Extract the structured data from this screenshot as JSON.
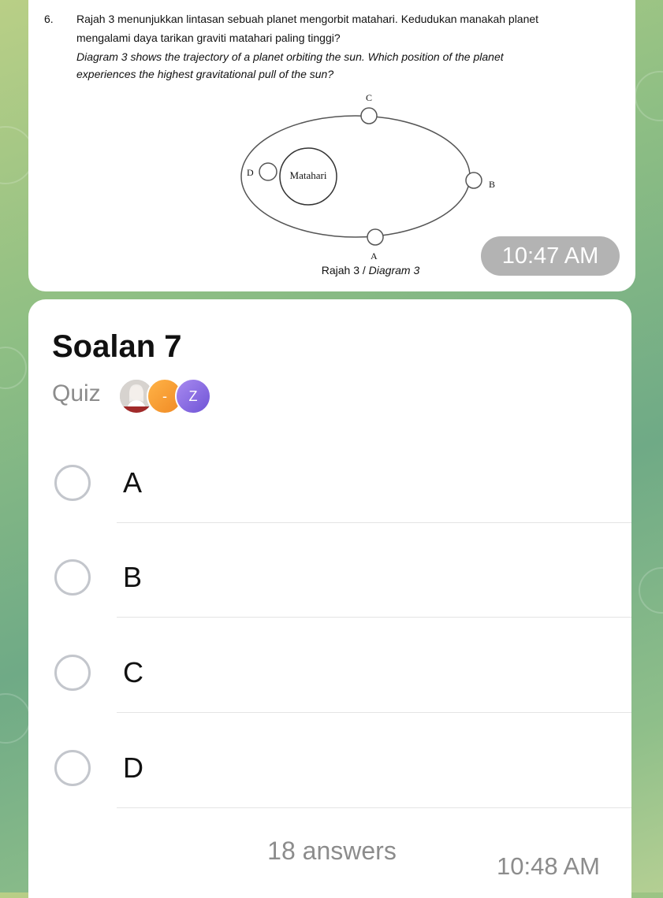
{
  "message1": {
    "question_number": "6.",
    "question_lines_ms": [
      "Rajah 3 menunjukkan lintasan sebuah planet mengorbit matahari. Kedudukan manakah planet",
      "mengalami daya tarikan graviti matahari paling tinggi?"
    ],
    "question_lines_en": [
      "Diagram 3 shows the trajectory of a planet orbiting the sun. Which position of the planet",
      "experiences the highest gravitational pull of the sun?"
    ],
    "diagram": {
      "sun_label": "Matahari",
      "position_labels": {
        "a": "A",
        "b": "B",
        "c": "C",
        "d": "D"
      },
      "caption_plain": "Rajah 3 / ",
      "caption_italic": "Diagram 3"
    },
    "time": "10:47 AM"
  },
  "poll": {
    "title": "Soalan 7",
    "type_label": "Quiz",
    "voter_avatars": [
      {
        "kind": "photo",
        "letter": ""
      },
      {
        "kind": "letter",
        "letter": "-",
        "color": "#f08a24"
      },
      {
        "kind": "letter",
        "letter": "Z",
        "color": "#6f54d6"
      }
    ],
    "options": [
      "A",
      "B",
      "C",
      "D"
    ],
    "answers": "18 answers",
    "time": "10:48 AM"
  }
}
